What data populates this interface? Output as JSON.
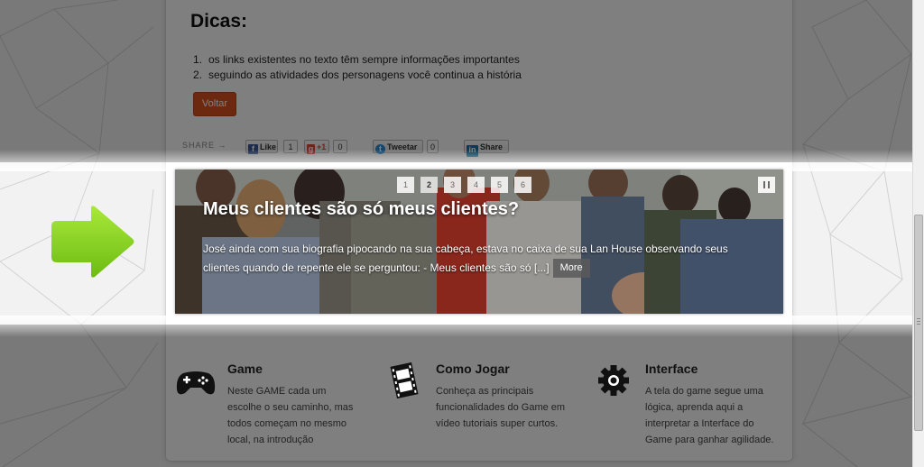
{
  "tips": {
    "title": "Dicas:",
    "items": [
      {
        "num": "1.",
        "text": "os links existentes no texto têm sempre informações importantes"
      },
      {
        "num": "2.",
        "text": "seguindo as atividades dos personagens você continua a história"
      }
    ],
    "back_label": "Voltar"
  },
  "share": {
    "label": "SHARE →",
    "facebook": {
      "icon": "facebook-icon",
      "label": "Like",
      "count": "1"
    },
    "google": {
      "icon": "google-plus-icon",
      "label": "+1",
      "count": "0"
    },
    "twitter": {
      "icon": "twitter-icon",
      "label": "Tweetar",
      "count": "0"
    },
    "linkedin": {
      "icon": "linkedin-icon",
      "label": "Share"
    }
  },
  "slider": {
    "title": "Meus clientes são só meus clientes?",
    "excerpt": "José ainda com sua biografia pipocando na sua cabeça, estava no caixa de sua Lan House observando seus clientes quando de repente ele se perguntou: - Meus clientes são só [...]",
    "more_label": "More",
    "pages": [
      "1",
      "2",
      "3",
      "4",
      "5",
      "6"
    ],
    "active_page": "2",
    "pause_icon": "pause-icon"
  },
  "features": [
    {
      "icon": "gamepad-icon",
      "title": "Game",
      "lines": [
        "Neste GAME cada um",
        "escolhe o seu caminho, mas",
        "todos começam no mesmo",
        "local, na introdução"
      ]
    },
    {
      "icon": "film-strip-icon",
      "title": "Como Jogar",
      "lines": [
        "Conheça as principais",
        "funcionalidades do Game em",
        "vídeo tutoriais super curtos."
      ]
    },
    {
      "icon": "gear-icon",
      "title": "Interface",
      "lines": [
        "A tela do game segue uma",
        "lógica, aprenda aqui a",
        "interpretar a Interface do",
        "Game para ganhar agilidade."
      ]
    }
  ],
  "colors": {
    "back_button": "#d9531e",
    "arrow": "#8fd31c",
    "facebook": "#3b5998",
    "google": "#dd4b39",
    "twitter": "#2b8fd8",
    "linkedin": "#0e76a8"
  },
  "indicators": {
    "arrow": "green-arrow-icon"
  }
}
